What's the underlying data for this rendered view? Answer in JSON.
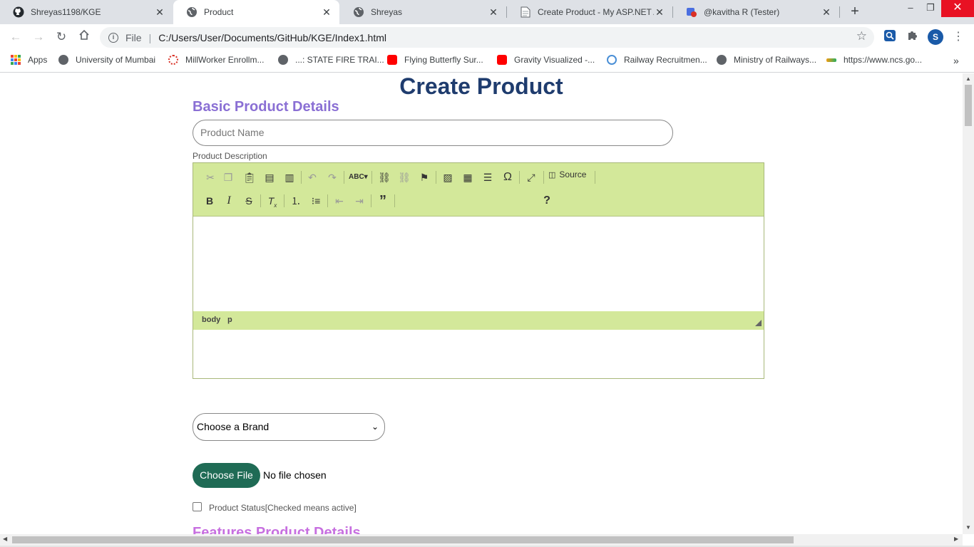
{
  "tabs": [
    {
      "title": "Shreyas1198/KGE",
      "icon": "github-icon"
    },
    {
      "title": "Product",
      "icon": "globe-icon",
      "active": true
    },
    {
      "title": "Shreyas",
      "icon": "globe-icon"
    },
    {
      "title": "Create Product - My ASP.NET Ap",
      "icon": "document-icon"
    },
    {
      "title": "@kavitha R (Tester)",
      "icon": "hangouts-icon"
    }
  ],
  "window_controls": {
    "minimize": "–",
    "restore": "❐",
    "close": "✕"
  },
  "toolbar": {
    "scheme_label": "File",
    "url": "C:/Users/User/Documents/GitHub/KGE/Index1.html",
    "profile_initial": "S"
  },
  "bookmarks": [
    {
      "label": "Apps",
      "icon": "apps-grid-icon"
    },
    {
      "label": "University of Mumbai",
      "icon": "globe-icon"
    },
    {
      "label": "MillWorker Enrollm...",
      "icon": "spinner-icon"
    },
    {
      "label": "...: STATE FIRE TRAI...",
      "icon": "globe-icon"
    },
    {
      "label": "Flying Butterfly Sur...",
      "icon": "youtube-icon"
    },
    {
      "label": "Gravity Visualized -...",
      "icon": "youtube-icon"
    },
    {
      "label": "Railway Recruitmen...",
      "icon": "emblem-icon"
    },
    {
      "label": "Ministry of Railways...",
      "icon": "globe-icon"
    },
    {
      "label": "https://www.ncs.go...",
      "icon": "ncs-icon"
    }
  ],
  "page": {
    "title": "Create Product",
    "section_basic": "Basic Product Details",
    "product_name_placeholder": "Product Name",
    "description_label": "Product Description",
    "editor": {
      "source_label": "Source",
      "help_label": "?",
      "path": [
        "body",
        "p"
      ]
    },
    "brand_select": "Choose a Brand",
    "file_button": "Choose File",
    "file_status": "No file chosen",
    "status_label": "Product Status[Checked means active]",
    "section_features": "Features Product Details"
  },
  "colors": {
    "title": "#1f3c6e",
    "section": "#8a6fd4",
    "editor_bar": "#d3e89a",
    "file_button": "#1f6b55"
  }
}
